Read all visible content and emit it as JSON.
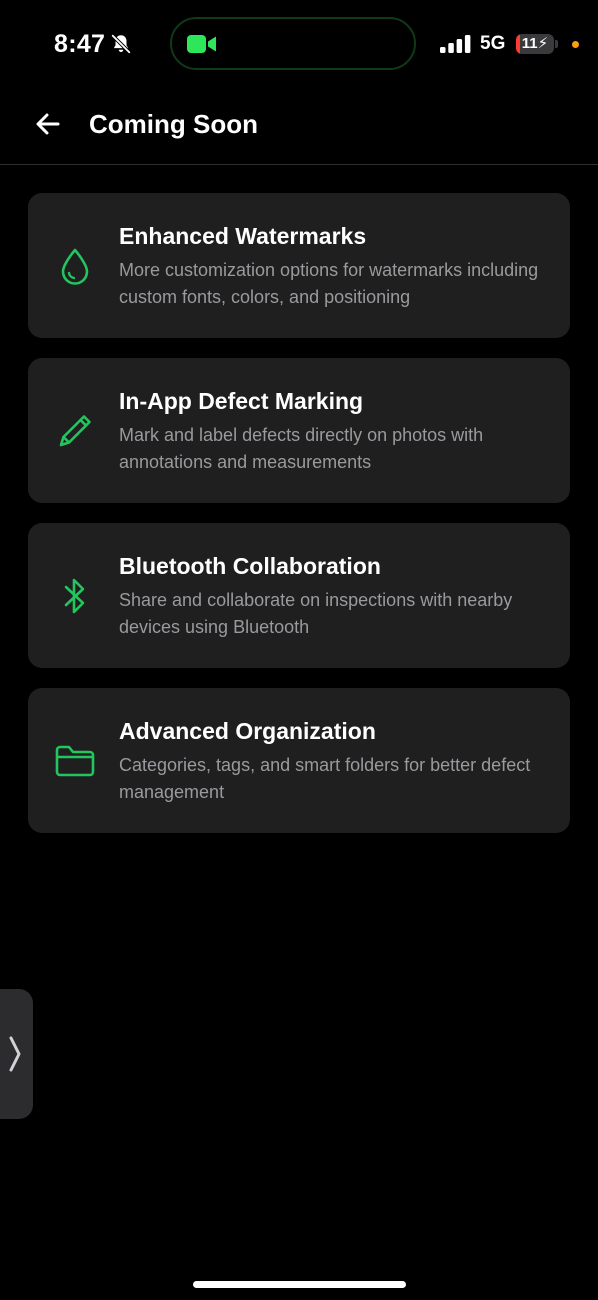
{
  "status_bar": {
    "time": "8:47",
    "network": "5G",
    "battery": "11",
    "battery_level_percent": 11,
    "icons": [
      "bell-slash-icon",
      "video-camera-icon",
      "signal-icon",
      "battery-charging-icon"
    ]
  },
  "header": {
    "back_icon": "arrow-left-icon",
    "title": "Coming Soon"
  },
  "features": [
    {
      "icon": "water-drop-icon",
      "title": "Enhanced Watermarks",
      "description": "More customization options for watermarks including custom fonts, colors, and positioning"
    },
    {
      "icon": "pencil-icon",
      "title": "In-App Defect Marking",
      "description": "Mark and label defects directly on photos with annotations and measurements"
    },
    {
      "icon": "bluetooth-icon",
      "title": "Bluetooth Collaboration",
      "description": "Share and collaborate on inspections with nearby devices using Bluetooth"
    },
    {
      "icon": "folder-icon",
      "title": "Advanced Organization",
      "description": "Categories, tags, and smart folders for better defect management"
    }
  ],
  "side_tab": {
    "icon": "chevron-right-icon"
  },
  "colors": {
    "background": "#000000",
    "card": "#1f1f20",
    "accent": "#22c55e",
    "facetime_green": "#2ee65a",
    "text_primary": "#ffffff",
    "text_secondary": "#9a9a9e",
    "battery_low": "#ff3b30",
    "privacy_dot": "#ff9f0a"
  }
}
